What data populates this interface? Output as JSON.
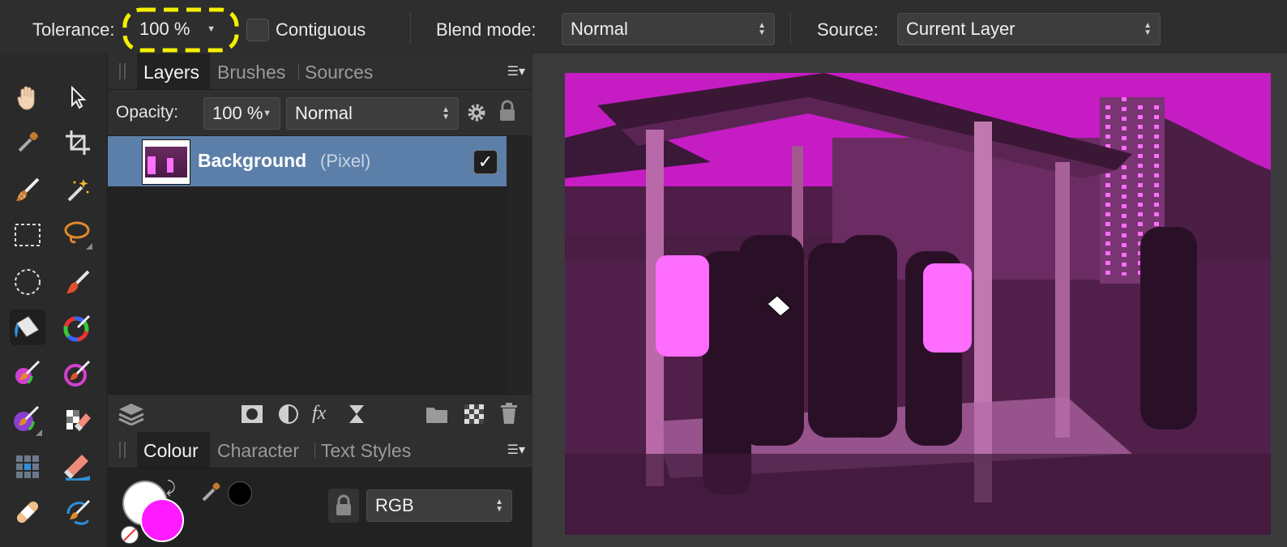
{
  "context_toolbar": {
    "tolerance_label": "Tolerance:",
    "tolerance_value": "100 %",
    "contiguous_label": "Contiguous",
    "contiguous_checked": false,
    "blend_mode_label": "Blend mode:",
    "blend_mode_value": "Normal",
    "source_label": "Source:",
    "source_value": "Current Layer",
    "highlight_color": "#f4f000"
  },
  "tools": [
    {
      "name": "view-tool",
      "icon": "hand-icon"
    },
    {
      "name": "move-tool",
      "icon": "arrow-pointer-icon"
    },
    {
      "name": "color-picker-tool",
      "icon": "eyedropper-icon"
    },
    {
      "name": "crop-tool",
      "icon": "crop-icon"
    },
    {
      "name": "selection-brush-tool",
      "icon": "selection-brush-icon"
    },
    {
      "name": "flood-select-tool",
      "icon": "magic-wand-icon"
    },
    {
      "name": "rectangular-marquee-tool",
      "icon": "rect-marquee-icon"
    },
    {
      "name": "freehand-selection-tool",
      "icon": "lasso-icon"
    },
    {
      "name": "elliptical-marquee-tool",
      "icon": "ellipse-marquee-icon"
    },
    {
      "name": "paint-brush-tool",
      "icon": "paint-brush-icon"
    },
    {
      "name": "flood-fill-tool",
      "icon": "paint-bucket-icon"
    },
    {
      "name": "color-replacement-tool",
      "icon": "color-wheel-brush-icon"
    },
    {
      "name": "pixel-tool",
      "icon": "pixel-brush-icon"
    },
    {
      "name": "mixer-brush-tool",
      "icon": "mixer-brush-icon"
    },
    {
      "name": "dodge-brush-tool",
      "icon": "dodge-brush-icon"
    },
    {
      "name": "erase-tool",
      "icon": "eraser-icon"
    },
    {
      "name": "patch-tool",
      "icon": "grid-icon"
    },
    {
      "name": "background-erase-tool",
      "icon": "background-eraser-icon"
    },
    {
      "name": "inpainting-tool",
      "icon": "band-aid-icon"
    },
    {
      "name": "smudge-tool",
      "icon": "smudge-icon"
    }
  ],
  "layers_panel": {
    "tabs": [
      "Layers",
      "Brushes",
      "Sources"
    ],
    "active_tab": "Layers",
    "opacity_label": "Opacity:",
    "opacity_value": "100 %",
    "blend_value": "Normal",
    "layers": [
      {
        "name": "Background",
        "type": "(Pixel)",
        "visible": true,
        "selected": true
      }
    ],
    "bottom_icons": [
      "layers-stack-icon",
      "mask-icon",
      "adjustment-icon",
      "fx-icon",
      "live-filter-icon",
      "folder-icon",
      "checker-icon",
      "trash-icon"
    ]
  },
  "colour_panel": {
    "tabs": [
      "Colour",
      "Character",
      "Text Styles"
    ],
    "active_tab": "Colour",
    "primary_color": "#ffffff",
    "secondary_color": "#ff1aff",
    "picked_color": "#000000",
    "model_value": "RGB"
  },
  "colors": {
    "selection_row": "#5b7fa8",
    "fill_color": "#ff00ff"
  }
}
